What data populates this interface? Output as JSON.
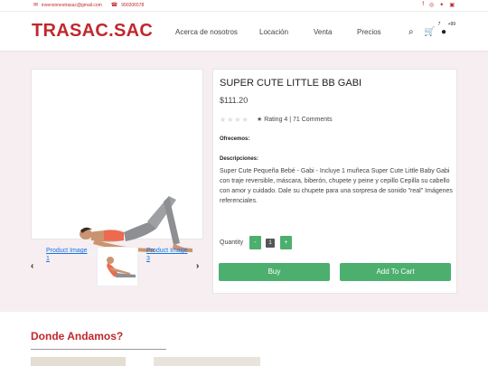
{
  "topbar": {
    "email": "inversionestrasac@gmail.com",
    "phone": "990206578",
    "social_icons": [
      "facebook-icon",
      "instagram-icon",
      "twitter-icon",
      "youtube-icon"
    ]
  },
  "header": {
    "logo": "TRASAC.SAC",
    "nav": [
      "Acerca de nosotros",
      "Locación",
      "Venta",
      "Precios"
    ],
    "wishlist_count": "7",
    "account_count": "+99"
  },
  "gallery": {
    "prev_arrow": "‹",
    "next_arrow": "›",
    "thumb1_alt": "Product Image 1",
    "thumb3_alt": "Product Image 3"
  },
  "product": {
    "title": "SUPER CUTE LITTLE BB GABI",
    "price": "$111.20",
    "rating_text": "Rating 4 | 71 Comments",
    "offer_label": "Ofrecemos:",
    "offer_value": "",
    "desc_label": "Descripciones:",
    "description": "Super Cute Pequeña Bebé - Gabi - Incluye 1 muñeca Super Cute Little Baby Gabi con traje reversible, máscara, biberón, chupete y peine y cepillo Cepilla su cabello con amor y cuidado. Dale su chupete para una sorpresa de sonido \"real\" Imágenes referenciales.",
    "quantity_label": "Quantity",
    "quantity_value": "1",
    "minus": "-",
    "plus": "+",
    "buy_label": "Buy",
    "cart_label": "Add To Cart"
  },
  "location": {
    "heading": "Donde Andamos?"
  },
  "colors": {
    "brand_red": "#c0282d",
    "button_green": "#4caf6e",
    "page_bg": "#f6eef0"
  }
}
